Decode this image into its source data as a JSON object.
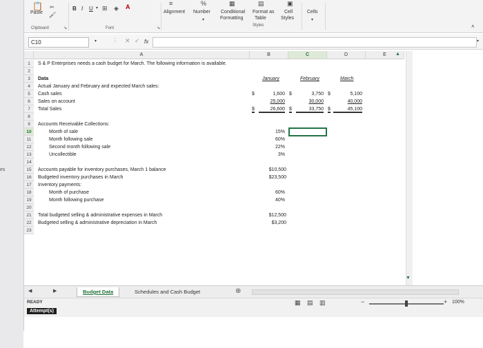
{
  "ribbon": {
    "paste_label": "Paste",
    "bold_label": "B",
    "italic_label": "I",
    "underline_label": "U",
    "clipboard_label": "Clipboard",
    "font_label": "Font",
    "alignment_label": "Alignment",
    "number_label": "Number",
    "conditional_label": "Conditional",
    "formatting_label": "Formatting",
    "format_as_label": "Format as",
    "table_label": "Table",
    "cell_label": "Cell",
    "styles_label": "Styles",
    "styles_group_label": "Styles",
    "cells_label": "Cells"
  },
  "formula_bar": {
    "name_box": "C10",
    "fx_label": "fx",
    "formula": ""
  },
  "grid": {
    "columns": [
      "A",
      "B",
      "C",
      "D",
      "E"
    ],
    "rows": [
      "1",
      "2",
      "3",
      "4",
      "5",
      "6",
      "7",
      "8",
      "9",
      "10",
      "11",
      "12",
      "13",
      "14",
      "15",
      "16",
      "17",
      "18",
      "19",
      "20",
      "21",
      "22",
      "23"
    ],
    "selected_row": "10",
    "selected_col": "C",
    "title": "S & P Enterprises needs a cash budget for March. The following information is available.",
    "data_label": "Data",
    "month_headers": [
      "January",
      "February",
      "March"
    ],
    "actual_label": "Actual January and February and expected March sales:",
    "cash_sales_label": "Cash sales",
    "sales_on_account_label": "Sales on account",
    "total_sales_label": "Total Sales",
    "currency": "$",
    "cash_sales": [
      "1,600",
      "3,750",
      "5,100"
    ],
    "sales_on_account": [
      "25,000",
      "30,000",
      "40,000"
    ],
    "total_sales": [
      "26,600",
      "33,750",
      "45,100"
    ],
    "ar_title": "Accounts Receivable Collections:",
    "ar_items": [
      {
        "label": "Month of sale",
        "value": "15%"
      },
      {
        "label": "Month following sale",
        "value": "60%"
      },
      {
        "label": "Second month following sale",
        "value": "22%"
      },
      {
        "label": "Uncollectible",
        "value": "3%"
      }
    ],
    "ap_label": "Accounts payable for inventory purchases, March 1 balance",
    "ap_value": "$10,500",
    "budgeted_inv_label": "Budgeted inventory purchases in March",
    "budgeted_inv_value": "$23,500",
    "inv_payments_label": "Inventory payments:",
    "month_purchase_label": "Month of purchase",
    "month_purchase_value": "60%",
    "month_following_purchase_label": "Month following purchase",
    "month_following_purchase_value": "40%",
    "total_sga_label": "Total budgeted selling & administrative expenses in March",
    "total_sga_value": "$12,500",
    "sga_dep_label": "Budgeted selling & administrative depreciation in March",
    "sga_dep_value": "$3,200"
  },
  "tabs": [
    "Budget Data",
    "Schedules and Cash Budget"
  ],
  "status": {
    "ready": "READY",
    "attempts": "Attempt(s)",
    "zoom": "100%"
  }
}
